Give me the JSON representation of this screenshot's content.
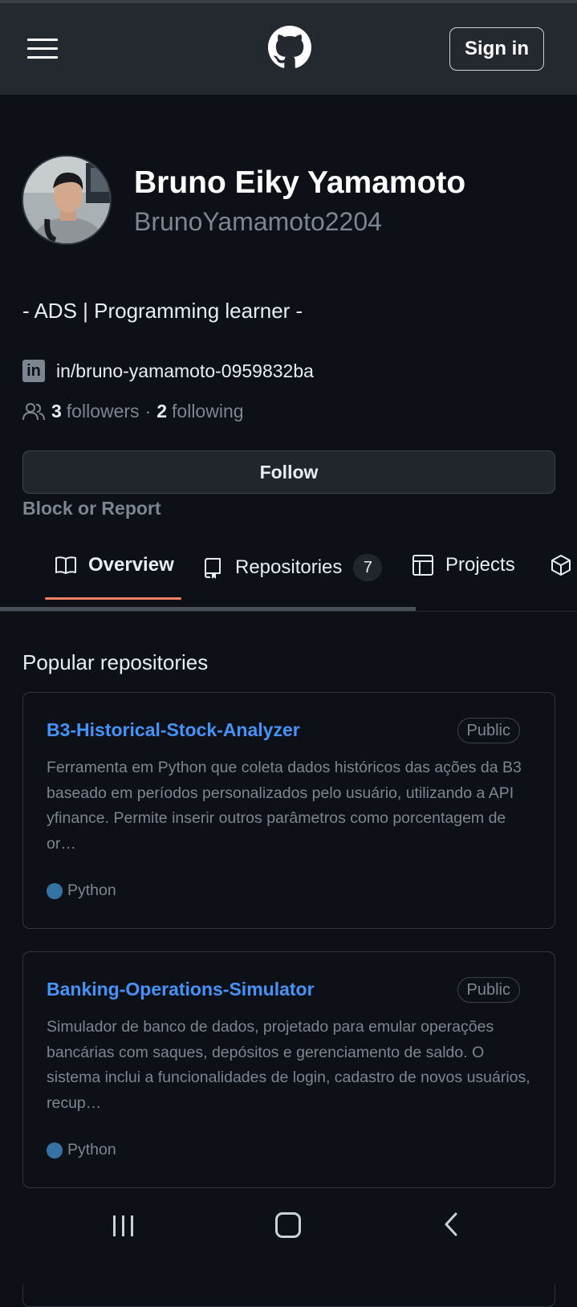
{
  "header": {
    "signin_label": "Sign in"
  },
  "profile": {
    "name": "Bruno Eiky Yamamoto",
    "username": "BrunoYamamoto2204",
    "bio": "- ADS | Programming learner -",
    "linkedin": "in/bruno-yamamoto-0959832ba",
    "followers_count": "3",
    "followers_label": "followers",
    "separator": "·",
    "following_count": "2",
    "following_label": "following",
    "follow_button": "Follow",
    "block_report": "Block or Report"
  },
  "tabs": [
    {
      "label": "Overview",
      "icon": "book-icon",
      "active": true
    },
    {
      "label": "Repositories",
      "icon": "repo-icon",
      "count": "7"
    },
    {
      "label": "Projects",
      "icon": "table-icon"
    }
  ],
  "popular": {
    "title": "Popular repositories",
    "repos": [
      {
        "name": "B3-Historical-Stock-Analyzer",
        "visibility": "Public",
        "description": "Ferramenta em Python que coleta dados históricos das ações da B3 baseado em períodos personalizados pelo usuário, utilizando a API yfinance. Permite inserir outros parâmetros como porcentagem de or…",
        "language": "Python",
        "language_color": "#3572A5"
      },
      {
        "name": "Banking-Operations-Simulator",
        "visibility": "Public",
        "description": "Simulador de banco de dados, projetado para emular operações bancárias com saques, depósitos e gerenciamento de saldo. O sistema inclui a funcionalidades de login, cadastro de novos usuários, recup…",
        "language": "Python",
        "language_color": "#3572A5"
      }
    ]
  }
}
